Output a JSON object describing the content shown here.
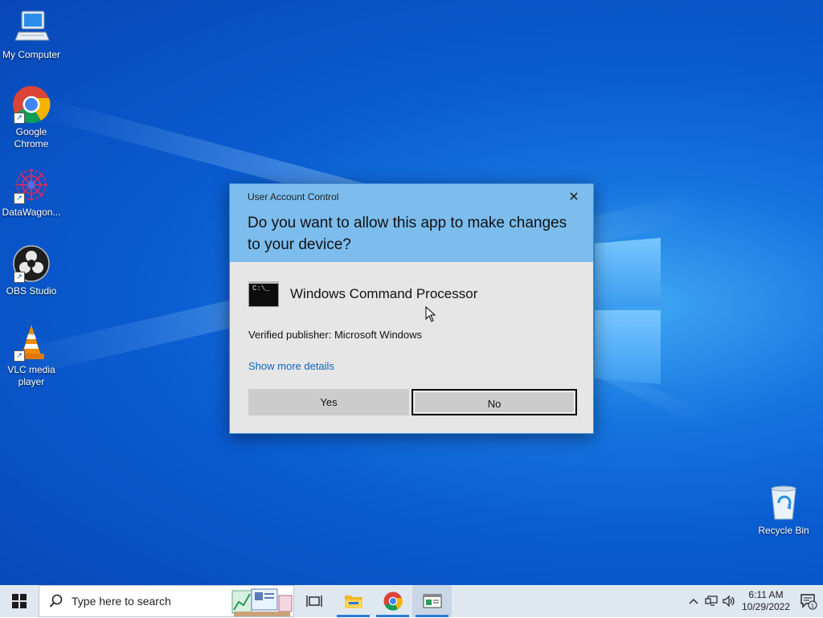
{
  "desktop": {
    "icons": [
      {
        "label": "My Computer",
        "icon": "computer-icon"
      },
      {
        "label": "Google Chrome",
        "icon": "chrome-icon"
      },
      {
        "label": "DataWagon...",
        "icon": "datawagon-icon"
      },
      {
        "label": "OBS Studio",
        "icon": "obs-icon"
      },
      {
        "label": "VLC media player",
        "icon": "vlc-icon"
      },
      {
        "label": "Recycle Bin",
        "icon": "recycle-bin-icon"
      }
    ]
  },
  "uac": {
    "title": "User Account Control",
    "close_glyph": "✕",
    "question": "Do you want to allow this app to make changes to your device?",
    "app_name": "Windows Command Processor",
    "app_icon_text": "C:\\_",
    "publisher": "Verified publisher: Microsoft Windows",
    "details_link": "Show more details",
    "yes_label": "Yes",
    "no_label": "No"
  },
  "taskbar": {
    "search_placeholder": "Type here to search",
    "apps": [
      "task-view-icon",
      "file-explorer-icon",
      "chrome-icon",
      "command-prompt-icon"
    ],
    "clock_time": "6:11 AM",
    "clock_date": "10/29/2022",
    "notification_count": "1"
  },
  "colors": {
    "uac_header": "#7cbdee",
    "link": "#0a66c2",
    "taskbar": "#dfe7f0"
  }
}
